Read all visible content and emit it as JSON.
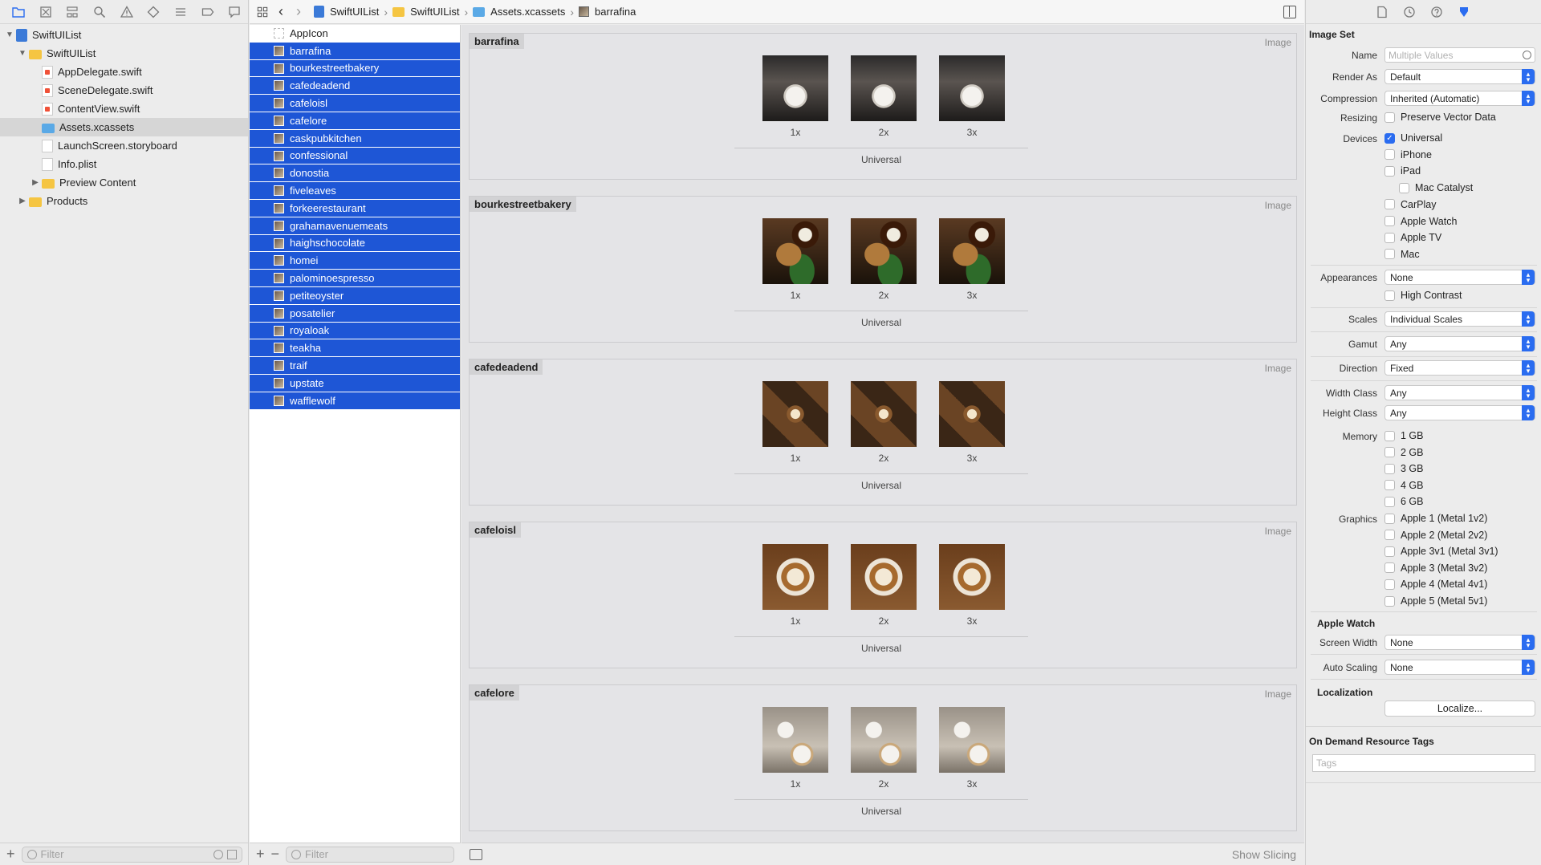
{
  "breadcrumbs": [
    "SwiftUIList",
    "SwiftUIList",
    "Assets.xcassets",
    "barrafina"
  ],
  "navigator": {
    "items": [
      {
        "label": "SwiftUIList",
        "indent": 0,
        "disclosure": "open",
        "kind": "project"
      },
      {
        "label": "SwiftUIList",
        "indent": 1,
        "disclosure": "open",
        "kind": "folder"
      },
      {
        "label": "AppDelegate.swift",
        "indent": 2,
        "disclosure": "",
        "kind": "swift"
      },
      {
        "label": "SceneDelegate.swift",
        "indent": 2,
        "disclosure": "",
        "kind": "swift"
      },
      {
        "label": "ContentView.swift",
        "indent": 2,
        "disclosure": "",
        "kind": "swift"
      },
      {
        "label": "Assets.xcassets",
        "indent": 2,
        "disclosure": "",
        "kind": "assets",
        "selected": true
      },
      {
        "label": "LaunchScreen.storyboard",
        "indent": 2,
        "disclosure": "",
        "kind": "storyboard"
      },
      {
        "label": "Info.plist",
        "indent": 2,
        "disclosure": "",
        "kind": "plist"
      },
      {
        "label": "Preview Content",
        "indent": 2,
        "disclosure": "closed",
        "kind": "folder"
      },
      {
        "label": "Products",
        "indent": 1,
        "disclosure": "closed",
        "kind": "folder"
      }
    ],
    "filter_placeholder": "Filter"
  },
  "asset_list": {
    "items": [
      {
        "label": "AppIcon",
        "selected": false
      },
      {
        "label": "barrafina",
        "selected": true
      },
      {
        "label": "bourkestreetbakery",
        "selected": true
      },
      {
        "label": "cafedeadend",
        "selected": true
      },
      {
        "label": "cafeloisl",
        "selected": true
      },
      {
        "label": "cafelore",
        "selected": true
      },
      {
        "label": "caskpubkitchen",
        "selected": true
      },
      {
        "label": "confessional",
        "selected": true
      },
      {
        "label": "donostia",
        "selected": true
      },
      {
        "label": "fiveleaves",
        "selected": true
      },
      {
        "label": "forkeerestaurant",
        "selected": true
      },
      {
        "label": "grahamavenuemeats",
        "selected": true
      },
      {
        "label": "haighschocolate",
        "selected": true
      },
      {
        "label": "homei",
        "selected": true
      },
      {
        "label": "palominoespresso",
        "selected": true
      },
      {
        "label": "petiteoyster",
        "selected": true
      },
      {
        "label": "posatelier",
        "selected": true
      },
      {
        "label": "royaloak",
        "selected": true
      },
      {
        "label": "teakha",
        "selected": true
      },
      {
        "label": "traif",
        "selected": true
      },
      {
        "label": "upstate",
        "selected": true
      },
      {
        "label": "wafflewolf",
        "selected": true
      }
    ],
    "filter_placeholder": "Filter"
  },
  "editor": {
    "sets": [
      {
        "name": "barrafina",
        "type": "Image",
        "scales": [
          "1x",
          "2x",
          "3x"
        ],
        "idiom": "Universal",
        "image": "food"
      },
      {
        "name": "bourkestreetbakery",
        "type": "Image",
        "scales": [
          "1x",
          "2x",
          "3x"
        ],
        "idiom": "Universal",
        "image": "bakery"
      },
      {
        "name": "cafedeadend",
        "type": "Image",
        "scales": [
          "1x",
          "2x",
          "3x"
        ],
        "idiom": "Universal",
        "image": "deadend"
      },
      {
        "name": "cafeloisl",
        "type": "Image",
        "scales": [
          "1x",
          "2x",
          "3x"
        ],
        "idiom": "Universal",
        "image": "loisl"
      },
      {
        "name": "cafelore",
        "type": "Image",
        "scales": [
          "1x",
          "2x",
          "3x"
        ],
        "idiom": "Universal",
        "image": "lore"
      }
    ],
    "show_slicing": "Show Slicing"
  },
  "inspector": {
    "image_set_title": "Image Set",
    "name_label": "Name",
    "name_placeholder": "Multiple Values",
    "render_as_label": "Render As",
    "render_as_value": "Default",
    "compression_label": "Compression",
    "compression_value": "Inherited (Automatic)",
    "resizing_label": "Resizing",
    "preserve_vector": "Preserve Vector Data",
    "devices_label": "Devices",
    "devices": [
      {
        "label": "Universal",
        "checked": true,
        "indent": 0
      },
      {
        "label": "iPhone",
        "checked": false,
        "indent": 0
      },
      {
        "label": "iPad",
        "checked": false,
        "indent": 0
      },
      {
        "label": "Mac Catalyst",
        "checked": false,
        "indent": 1
      },
      {
        "label": "CarPlay",
        "checked": false,
        "indent": 0
      },
      {
        "label": "Apple Watch",
        "checked": false,
        "indent": 0
      },
      {
        "label": "Apple TV",
        "checked": false,
        "indent": 0
      },
      {
        "label": "Mac",
        "checked": false,
        "indent": 0
      }
    ],
    "appearances_label": "Appearances",
    "appearances_value": "None",
    "high_contrast": "High Contrast",
    "scales_label": "Scales",
    "scales_value": "Individual Scales",
    "gamut_label": "Gamut",
    "gamut_value": "Any",
    "direction_label": "Direction",
    "direction_value": "Fixed",
    "width_class_label": "Width Class",
    "width_class_value": "Any",
    "height_class_label": "Height Class",
    "height_class_value": "Any",
    "memory_label": "Memory",
    "memory": [
      "1 GB",
      "2 GB",
      "3 GB",
      "4 GB",
      "6 GB"
    ],
    "graphics_label": "Graphics",
    "graphics": [
      "Apple 1 (Metal 1v2)",
      "Apple 2 (Metal 2v2)",
      "Apple 3v1 (Metal 3v1)",
      "Apple 3 (Metal 3v2)",
      "Apple 4 (Metal 4v1)",
      "Apple 5 (Metal 5v1)"
    ],
    "apple_watch_title": "Apple Watch",
    "screen_width_label": "Screen Width",
    "screen_width_value": "None",
    "auto_scaling_label": "Auto Scaling",
    "auto_scaling_value": "None",
    "localization_title": "Localization",
    "localize_button": "Localize...",
    "odr_title": "On Demand Resource Tags",
    "tags_placeholder": "Tags"
  },
  "colors": {
    "selection": "#1e56d6",
    "accent": "#2a6cf0",
    "folder": "#f5c542"
  }
}
